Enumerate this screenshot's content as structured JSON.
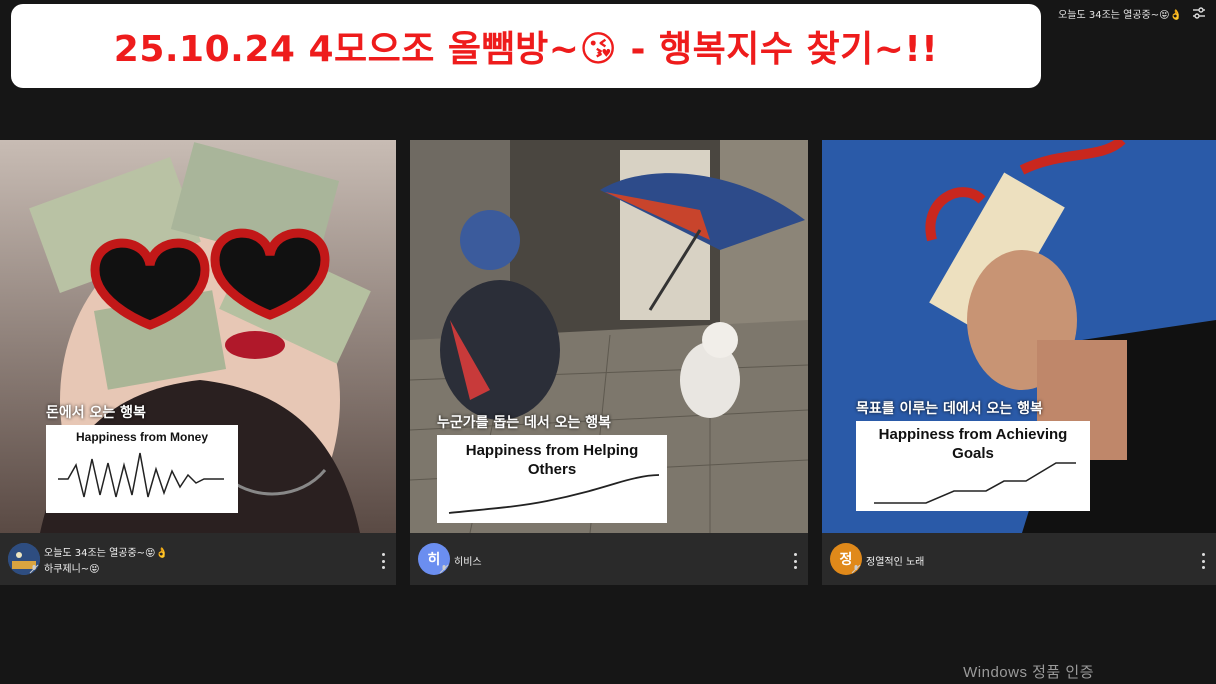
{
  "banner": {
    "title": "25.10.24  4모으조 올뺌방~😘 - 행복지수 찾기~!!"
  },
  "top_right": {
    "status_text": "오늘도 34조는 열공중~😝👌",
    "settings_icon": "sliders-icon"
  },
  "tiles": [
    {
      "caption": "돈에서 오는 행복",
      "card_title": "Happiness from Money",
      "footer_name": "오늘도 34조는 열공중~😝👌",
      "footer_sub": "하쿠제니~😝",
      "avatar_letter": "",
      "avatar_color": "#3a5a8c"
    },
    {
      "caption": "누군가를 돕는 데서 오는 행복",
      "card_title": "Happiness from Helping Others",
      "footer_name": "히비스",
      "avatar_letter": "히",
      "avatar_color": "#6b8ef0"
    },
    {
      "caption": "목표를 이루는 데에서 오는 행복",
      "card_title": "Happiness from Achieving Goals",
      "footer_name": "정열적인 노래",
      "avatar_letter": "정",
      "avatar_color": "#e0891a"
    }
  ],
  "watermark": "Windows 정품 인증",
  "colors": {
    "banner_text": "#ee1c1c",
    "footer_bg": "#2a2a2a",
    "page_bg": "#161616"
  }
}
